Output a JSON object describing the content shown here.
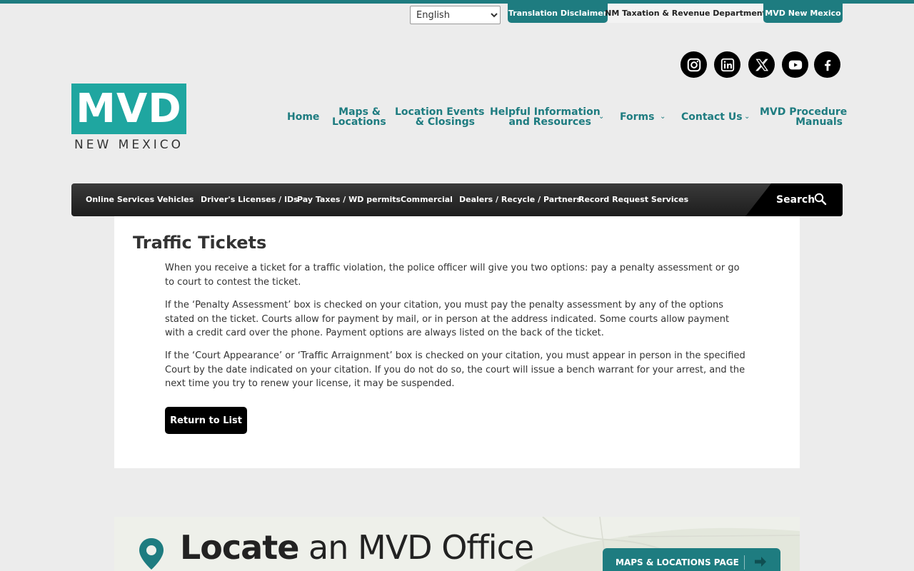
{
  "utility": {
    "language_selected": "English",
    "language_options": [
      "English"
    ],
    "disclaimer": "Translation Disclaimer",
    "nmtrd": "NM Taxation & Revenue Department",
    "mvd_nm": "MVD New Mexico"
  },
  "social": [
    "instagram-icon",
    "linkedin-icon",
    "x-icon",
    "youtube-icon",
    "facebook-icon"
  ],
  "logo": {
    "main": "MVD",
    "sub": "NEW MEXICO"
  },
  "mainnav": {
    "home": "Home",
    "maps_l1": "Maps &",
    "maps_l2": "Locations",
    "events_l1": "Location Events",
    "events_l2": "& Closings",
    "helpful_l1": "Helpful Information",
    "helpful_l2": "and Resources",
    "forms": "Forms",
    "contact": "Contact Us",
    "manuals_l1": "MVD Procedure",
    "manuals_l2": "Manuals"
  },
  "darknav": {
    "online": "Online Services",
    "vehicles": "Vehicles",
    "licenses": "Driver's Licenses / IDs",
    "taxes": "Pay Taxes / WD permits",
    "commercial": "Commercial",
    "dealers": "Dealers / Recycle / Partners",
    "records": "Record Request Services",
    "search": "Search"
  },
  "content": {
    "title": "Traffic Tickets",
    "p1": "When you receive a ticket for a traffic violation, the police officer will give you two options: pay a penalty assessment or go to court to contest the ticket.",
    "p2": "If the ‘Penalty Assessment’ box is checked on your citation, you must pay the penalty assessment by any of the options stated on the ticket. Courts allow for payment by mail, or in person at the address indicated. Some courts allow payment with a credit card over the phone. Payment options are always listed on the back of the ticket.",
    "p3": "If the ‘Court Appearance’ or ‘Traffic Arraignment’ box is checked on your citation, you must appear in person in the specified Court by the date indicated on your citation. If you do not do so, the court will issue a bench warrant for your arrest, and the next time you try to renew your license, it may be suspended.",
    "return_btn": "Return to List"
  },
  "locate": {
    "title_bold": "Locate",
    "title_rest": " an MVD Office",
    "maps_btn": "MAPS & LOCATIONS PAGE"
  },
  "colors": {
    "teal": "#1e7c80",
    "logo_teal": "#1fa6a0",
    "dark": "#1d1d1d"
  }
}
